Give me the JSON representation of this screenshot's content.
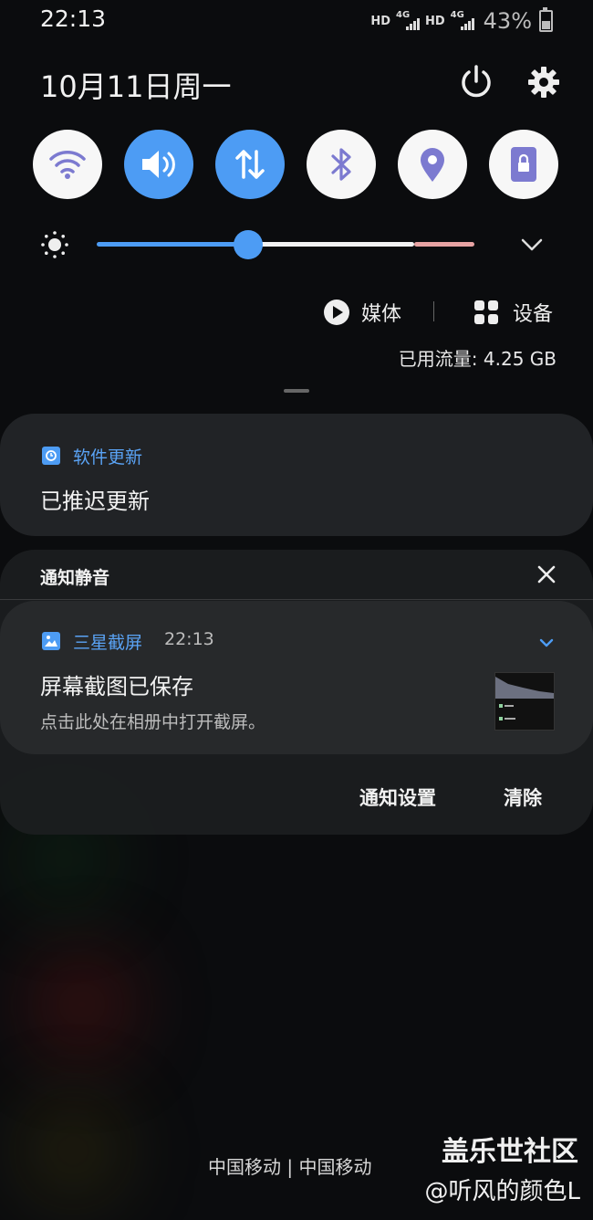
{
  "status_bar": {
    "time": "22:13",
    "hd1": "HD",
    "net1": "4G",
    "hd2": "HD",
    "net2": "4G",
    "battery": "43%"
  },
  "header": {
    "date": "10月11日周一"
  },
  "toggles": [
    {
      "icon": "wifi-icon",
      "on": false
    },
    {
      "icon": "sound-icon",
      "on": true
    },
    {
      "icon": "mobile-data-icon",
      "on": true
    },
    {
      "icon": "bluetooth-icon",
      "on": false
    },
    {
      "icon": "location-icon",
      "on": false
    },
    {
      "icon": "screen-lock-icon",
      "on": false
    }
  ],
  "brightness": {
    "level": 0.4
  },
  "media": {
    "media_label": "媒体",
    "devices_label": "设备",
    "data_usage": "已用流量: 4.25 GB"
  },
  "notifications": {
    "software_update": {
      "app": "软件更新",
      "title": "已推迟更新"
    },
    "silent_group": {
      "header": "通知静音",
      "screenshot": {
        "app": "三星截屏",
        "time": "22:13",
        "title": "屏幕截图已保存",
        "text": "点击此处在相册中打开截屏。"
      },
      "settings_label": "通知设置",
      "clear_label": "清除"
    }
  },
  "footer": {
    "carrier": "中国移动 | 中国移动"
  },
  "watermark": {
    "line1": "盖乐世社区",
    "line2": "@听风的颜色L"
  },
  "colors": {
    "accent": "#4d9cf4",
    "background": "#0b0c0e",
    "card": "#242628"
  }
}
